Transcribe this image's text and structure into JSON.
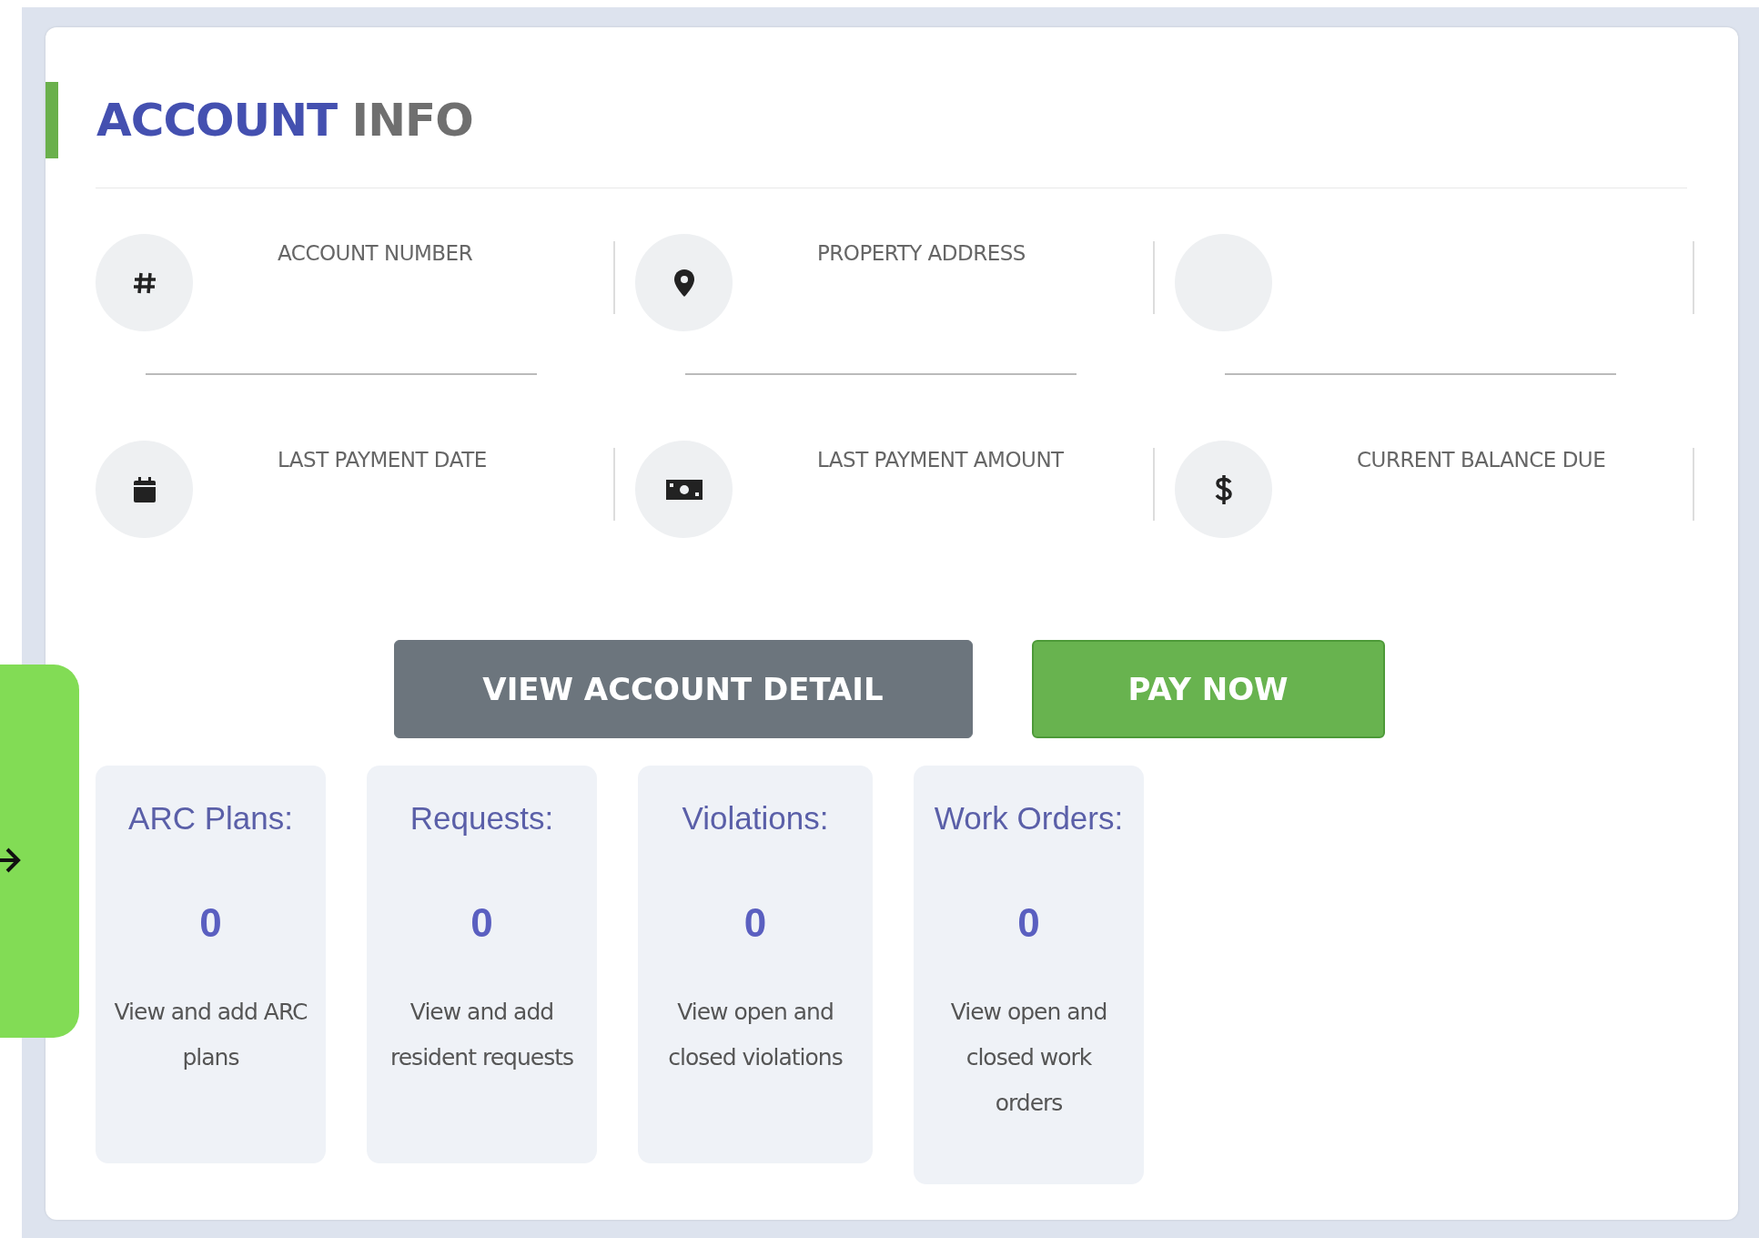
{
  "header": {
    "title_main": "ACCOUNT",
    "title_rest": "INFO"
  },
  "info_items": [
    {
      "kind": "hash",
      "label": "ACCOUNT NUMBER"
    },
    {
      "kind": "pin",
      "label": "PROPERTY ADDRESS"
    },
    {
      "kind": "blank"
    },
    {
      "kind": "calendar",
      "label": "LAST PAYMENT DATE"
    },
    {
      "kind": "money",
      "label": "LAST PAYMENT AMOUNT"
    },
    {
      "kind": "dollar",
      "label": "CURRENT BALANCE DUE"
    }
  ],
  "buttons": [
    {
      "kind": "secondary",
      "label": "VIEW ACCOUNT DETAIL"
    },
    {
      "kind": "success",
      "label": "PAY NOW"
    }
  ],
  "stats": [
    {
      "title": "ARC Plans:",
      "count": "0",
      "description": "View and add ARC plans"
    },
    {
      "title": "Requests:",
      "count": "0",
      "description": "View and add resident requests"
    },
    {
      "title": "Violations:",
      "count": "0",
      "description": "View open and closed violations"
    },
    {
      "title": "Work Orders:",
      "count": "0",
      "description": "View open and closed work orders"
    }
  ]
}
